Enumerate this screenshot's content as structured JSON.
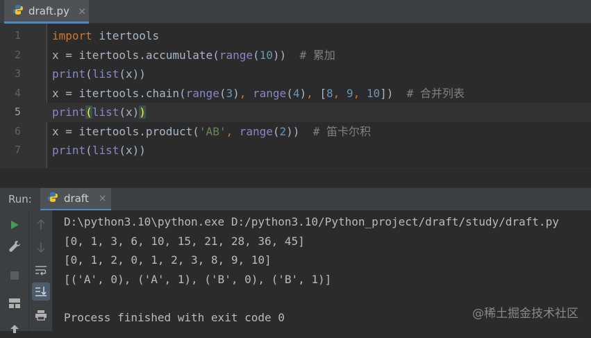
{
  "editor_tab": {
    "filename": "draft.py",
    "close_glyph": "×"
  },
  "code_lines": [
    {
      "num": "1",
      "tokens": [
        {
          "t": "import",
          "c": "kw"
        },
        {
          "t": " itertools",
          "c": ""
        }
      ]
    },
    {
      "num": "2",
      "tokens": [
        {
          "t": "x = itertools.accumulate(",
          "c": ""
        },
        {
          "t": "range",
          "c": "bi"
        },
        {
          "t": "(",
          "c": ""
        },
        {
          "t": "10",
          "c": "num"
        },
        {
          "t": "))  ",
          "c": ""
        },
        {
          "t": "# 累加",
          "c": "cmt"
        }
      ]
    },
    {
      "num": "3",
      "tokens": [
        {
          "t": "print",
          "c": "bi"
        },
        {
          "t": "(",
          "c": ""
        },
        {
          "t": "list",
          "c": "bi"
        },
        {
          "t": "(x))",
          "c": ""
        }
      ]
    },
    {
      "num": "4",
      "tokens": [
        {
          "t": "x = itertools.chain(",
          "c": ""
        },
        {
          "t": "range",
          "c": "bi"
        },
        {
          "t": "(",
          "c": ""
        },
        {
          "t": "3",
          "c": "num"
        },
        {
          "t": ")",
          "c": ""
        },
        {
          "t": ", ",
          "c": "kw"
        },
        {
          "t": "range",
          "c": "bi"
        },
        {
          "t": "(",
          "c": ""
        },
        {
          "t": "4",
          "c": "num"
        },
        {
          "t": ")",
          "c": ""
        },
        {
          "t": ", ",
          "c": "kw"
        },
        {
          "t": "[",
          "c": ""
        },
        {
          "t": "8",
          "c": "num"
        },
        {
          "t": ", ",
          "c": "kw"
        },
        {
          "t": "9",
          "c": "num"
        },
        {
          "t": ", ",
          "c": "kw"
        },
        {
          "t": "10",
          "c": "num"
        },
        {
          "t": "])  ",
          "c": ""
        },
        {
          "t": "# 合并列表",
          "c": "cmt"
        }
      ]
    },
    {
      "num": "5",
      "current": true,
      "tokens": [
        {
          "t": "print",
          "c": "bi"
        },
        {
          "t": "(",
          "c": "brace-hl"
        },
        {
          "t": "list",
          "c": "bi"
        },
        {
          "t": "(x)",
          "c": ""
        },
        {
          "t": ")",
          "c": "brace-hl"
        }
      ]
    },
    {
      "num": "6",
      "tokens": [
        {
          "t": "x = itertools.product(",
          "c": ""
        },
        {
          "t": "'AB'",
          "c": "str"
        },
        {
          "t": ", ",
          "c": "kw"
        },
        {
          "t": "range",
          "c": "bi"
        },
        {
          "t": "(",
          "c": ""
        },
        {
          "t": "2",
          "c": "num"
        },
        {
          "t": "))  ",
          "c": ""
        },
        {
          "t": "# 笛卡尔积",
          "c": "cmt"
        }
      ]
    },
    {
      "num": "7",
      "tokens": [
        {
          "t": "print",
          "c": "bi"
        },
        {
          "t": "(",
          "c": ""
        },
        {
          "t": "list",
          "c": "bi"
        },
        {
          "t": "(x))",
          "c": ""
        }
      ]
    }
  ],
  "run_panel": {
    "label": "Run:",
    "tab_name": "draft",
    "close_glyph": "×"
  },
  "console_lines": [
    "D:\\python3.10\\python.exe D:/python3.10/Python_project/draft/study/draft.py",
    "[0, 1, 3, 6, 10, 15, 21, 28, 36, 45]",
    "[0, 1, 2, 0, 1, 2, 3, 8, 9, 10]",
    "[('A', 0), ('A', 1), ('B', 0), ('B', 1)]",
    "",
    "Process finished with exit code 0"
  ],
  "watermark": "@稀土掘金技术社区",
  "left_toolbar_icons": [
    "run-icon",
    "wrench-icon",
    "stop-icon",
    "layout-icon",
    "pin-icon"
  ],
  "second_toolbar_icons": [
    "arrow-up-icon",
    "arrow-down-icon",
    "soft-wrap-icon",
    "scroll-to-end-icon",
    "print-icon"
  ],
  "colors": {
    "keyword": "#cc7832",
    "builtin": "#8888c6",
    "number": "#6897bb",
    "string": "#6a8759",
    "comment": "#808080",
    "run_green": "#499c54",
    "tab_underline": "#4a88c7"
  }
}
